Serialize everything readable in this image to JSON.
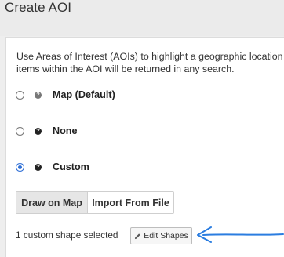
{
  "page": {
    "title": "Create AOI"
  },
  "description": {
    "line1": "Use Areas of Interest (AOIs) to highlight a geographic location o",
    "line2": "items within the AOI will be returned in any search."
  },
  "options": [
    {
      "label": "Map (Default)",
      "checked": false,
      "help": "?"
    },
    {
      "label": "None",
      "checked": false,
      "help": "?"
    },
    {
      "label": "Custom",
      "checked": true,
      "help": "?"
    }
  ],
  "mode_buttons": {
    "draw": "Draw on Map",
    "import": "Import From File"
  },
  "shapes": {
    "status": "1 custom shape selected",
    "edit_label": "Edit Shapes"
  },
  "colors": {
    "accent": "#2f6fd6",
    "annotation": "#2b7de0"
  }
}
